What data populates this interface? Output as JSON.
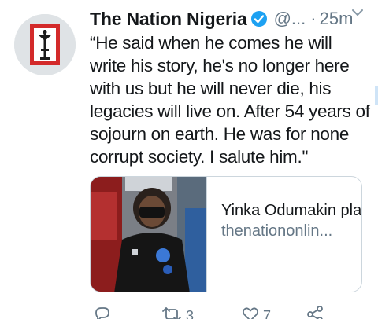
{
  "tweet": {
    "display_name": "The Nation Nigeria",
    "handle": "@...",
    "separator": "·",
    "time": "25m",
    "text": "“He said when he comes he will write his story, he's no longer here with us but he will never die, his legacies will live on. After 54 years of sojourn on earth. He was for none corrupt society. I salute him.\"",
    "card": {
      "title": "Yinka Odumakin planned to writ...",
      "domain": "thenationonlin..."
    },
    "actions": {
      "retweets": "3",
      "likes": "7"
    },
    "icons": [
      "verified-icon",
      "chevron-down-icon",
      "reply-icon",
      "retweet-icon",
      "like-icon",
      "share-icon"
    ],
    "colors": {
      "verified": "#1da1f2",
      "text": "#14171a",
      "secondary": "#657786",
      "avatar_red": "#d32a2a"
    }
  }
}
